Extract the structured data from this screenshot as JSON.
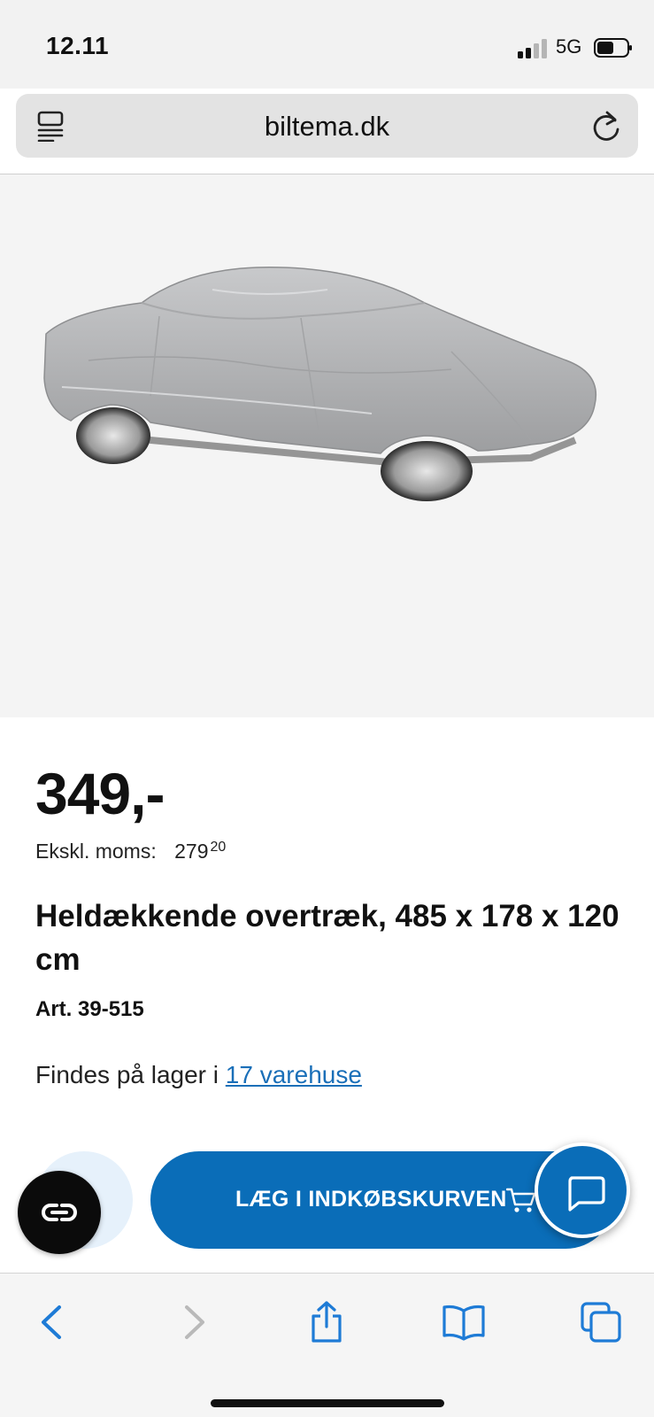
{
  "status_bar": {
    "time": "12.11",
    "network": "5G"
  },
  "browser": {
    "url": "biltema.dk"
  },
  "product": {
    "image_alt": "car-cover",
    "price": "349,-",
    "vat_label": "Ekskl. moms:",
    "vat_value": "279",
    "vat_cents": "20",
    "title": "Heldækkende overtræk, 485 x 178 x 120 cm",
    "article": "Art. 39-515",
    "stock_prefix": "Findes på lager i",
    "stock_link": "17 varehuse"
  },
  "actions": {
    "cart_label": "LÆG I INDKØBSKURVEN"
  },
  "colors": {
    "accent": "#0a6db8",
    "link": "#1a6fb8"
  },
  "icons": [
    "tabs-icon",
    "reload-icon",
    "accessibility-icon",
    "cart-icon",
    "chat-icon",
    "back-icon",
    "forward-icon",
    "share-icon",
    "bookmarks-icon",
    "tabs-overview-icon"
  ]
}
